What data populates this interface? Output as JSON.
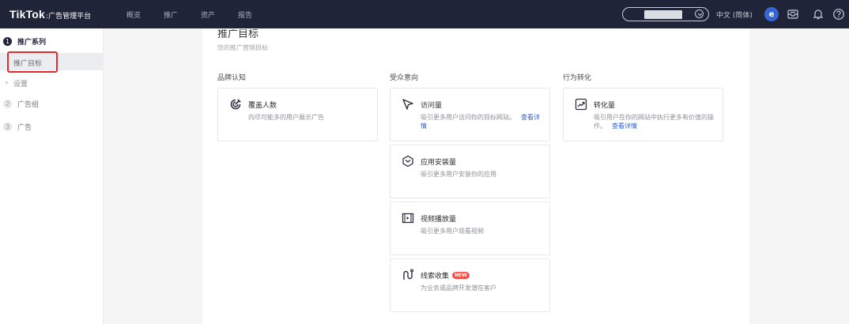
{
  "topbar": {
    "brand": "TikTok",
    "brand_suffix": ":广告管理平台",
    "nav": [
      "概览",
      "推广",
      "资产",
      "报告"
    ],
    "language": "中文 (简体)",
    "avatar_letter": "e"
  },
  "sidebar": {
    "steps": [
      {
        "num": "1",
        "label": "推广系列",
        "active": true
      },
      {
        "num": "2",
        "label": "广告组",
        "active": false
      },
      {
        "num": "3",
        "label": "广告",
        "active": false
      }
    ],
    "substeps": [
      {
        "label": "推广目标",
        "active": true
      },
      {
        "label": "设置",
        "active": false
      }
    ]
  },
  "main": {
    "title": "推广目标",
    "description": "您的推广营销目标",
    "columns": [
      {
        "heading": "品牌认知",
        "cards": [
          {
            "icon": "target-icon",
            "title": "覆盖人数",
            "desc": "向尽可能多的用户展示广告",
            "link": ""
          }
        ]
      },
      {
        "heading": "受众意向",
        "cards": [
          {
            "icon": "cursor-arrow-icon",
            "title": "访问量",
            "desc": "吸引更多用户访问你的目标网站。",
            "link": "查看详情"
          },
          {
            "icon": "app-install-icon",
            "title": "应用安装量",
            "desc": "吸引更多用户安装你的应用",
            "link": ""
          },
          {
            "icon": "video-icon",
            "title": "视频播放量",
            "desc": "吸引更多用户观看视频",
            "link": ""
          },
          {
            "icon": "lead-icon",
            "title": "线索收集",
            "desc": "为业务或品牌开发潜在客户",
            "link": "",
            "badge": "NEW"
          }
        ]
      },
      {
        "heading": "行为转化",
        "cards": [
          {
            "icon": "trend-chart-icon",
            "title": "转化量",
            "desc": "吸引用户在你的网站中执行更多有价值的操作。",
            "link": "查看详情"
          }
        ]
      }
    ]
  },
  "colors": {
    "topbar_bg": "#1f2438",
    "accent_red": "#e22b2b",
    "link_blue": "#2c62d1",
    "badge_red": "#f2504b"
  }
}
